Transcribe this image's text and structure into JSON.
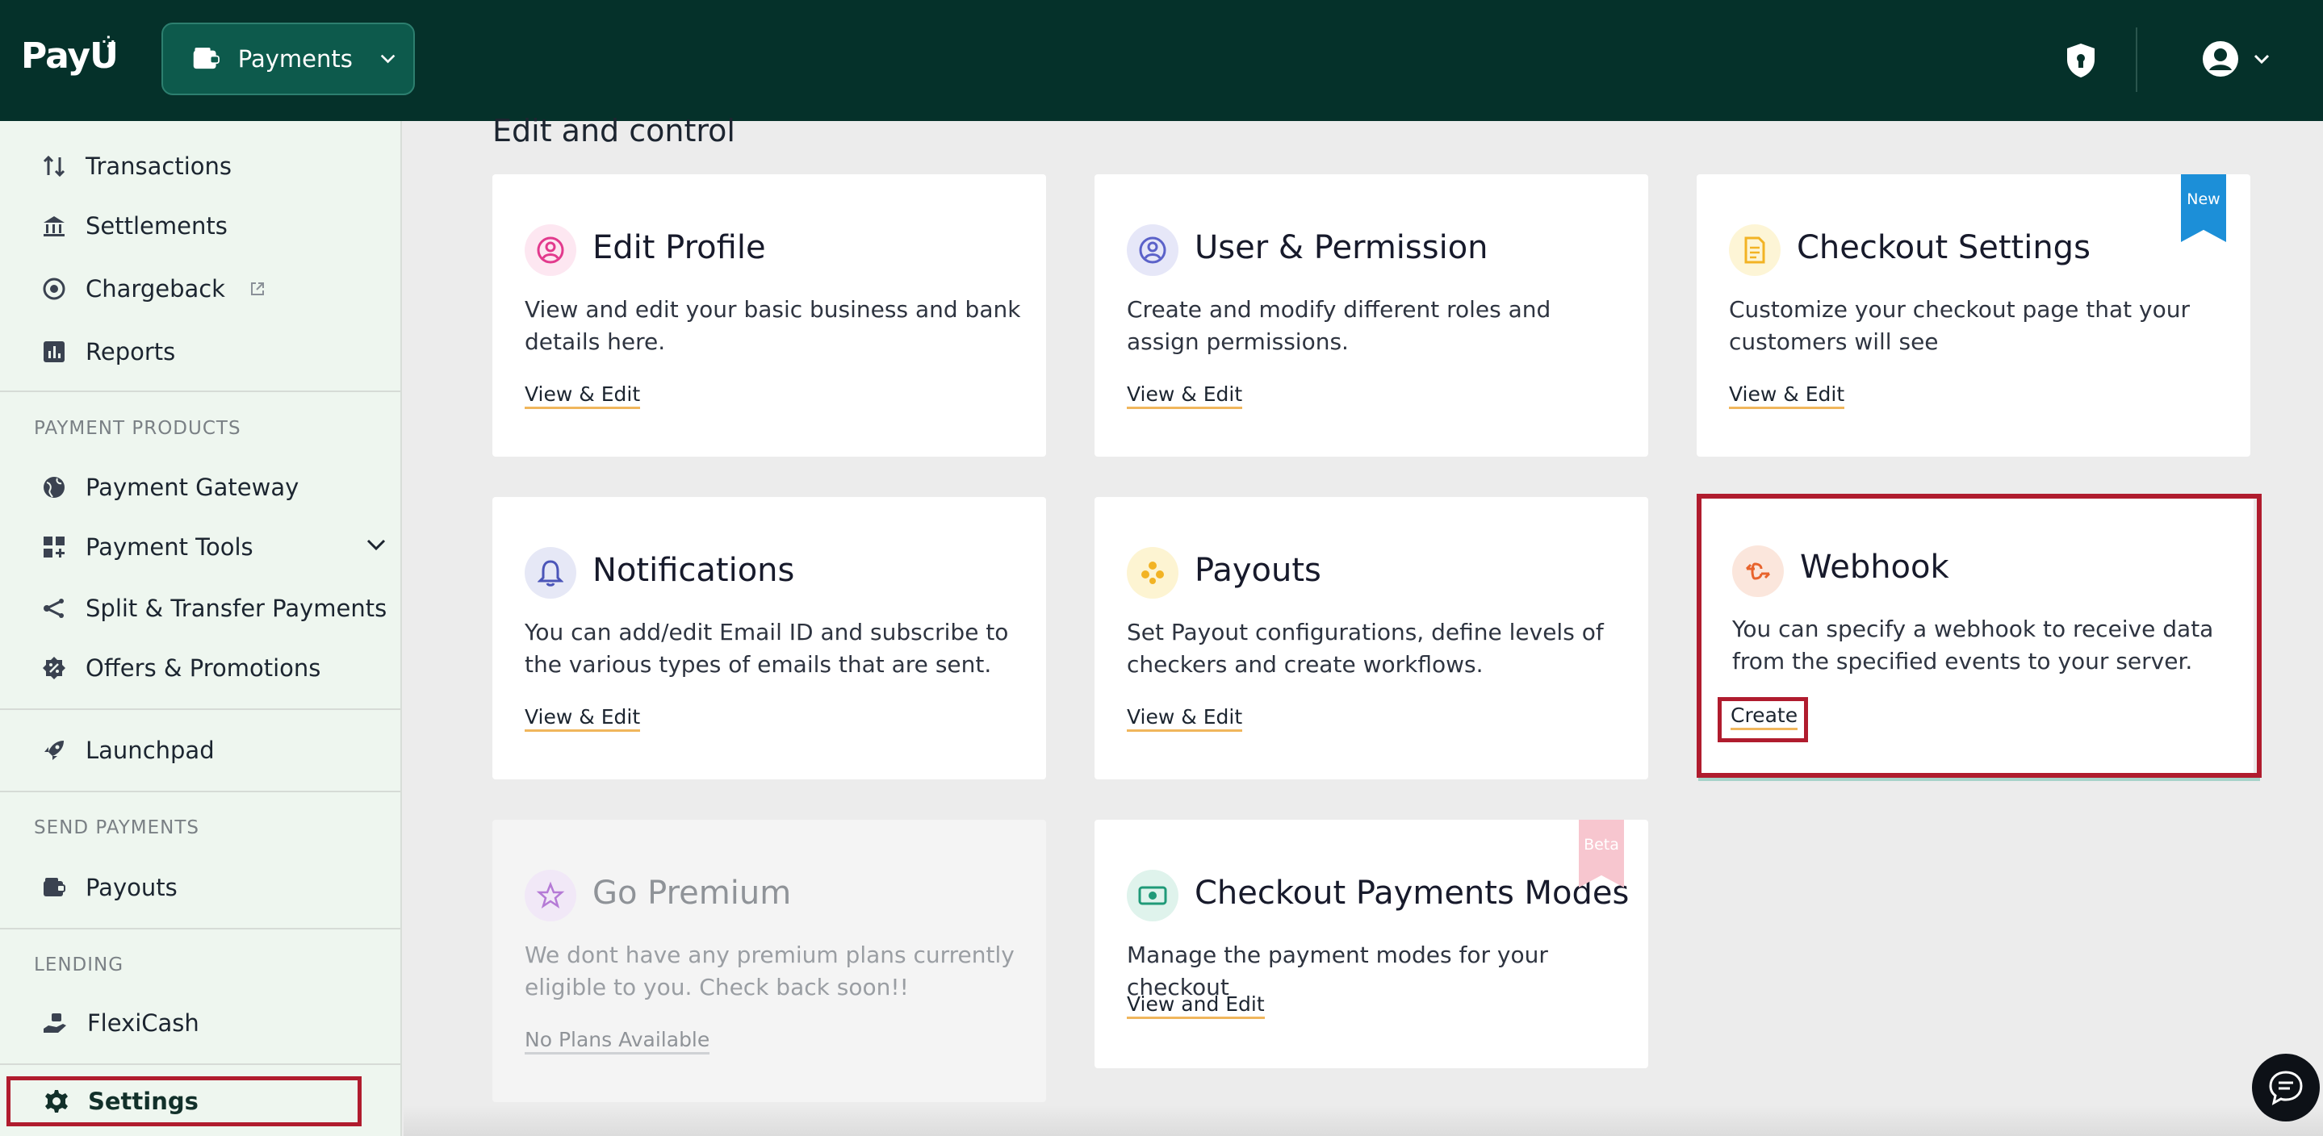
{
  "header": {
    "logo": "PayU",
    "product_switch": "Payments"
  },
  "sidebar": {
    "items_top": [
      {
        "label": "Transactions"
      },
      {
        "label": "Settlements"
      },
      {
        "label": "Chargeback"
      },
      {
        "label": "Reports"
      }
    ],
    "payment_products": {
      "title": "PAYMENT PRODUCTS",
      "items": [
        {
          "label": "Payment Gateway"
        },
        {
          "label": "Payment Tools"
        },
        {
          "label": "Split & Transfer Payments"
        },
        {
          "label": "Offers & Promotions"
        }
      ]
    },
    "launchpad": "Launchpad",
    "send_payments": {
      "title": "SEND PAYMENTS",
      "items": [
        {
          "label": "Payouts"
        }
      ]
    },
    "lending": {
      "title": "LENDING",
      "items": [
        {
          "label": "FlexiCash"
        }
      ]
    },
    "settings": "Settings"
  },
  "main": {
    "section_title": "Edit and control",
    "cards": [
      {
        "title": "Edit Profile",
        "desc": "View and edit your basic business and bank details here.",
        "link": "View & Edit",
        "icon_color": "#e23a8d",
        "icon_bg": "#fde7f1"
      },
      {
        "title": "User & Permission",
        "desc": "Create and modify different roles and assign permissions.",
        "link": "View & Edit",
        "icon_color": "#5b62c9",
        "icon_bg": "#e6e7f8"
      },
      {
        "title": "Checkout Settings",
        "desc": "Customize your checkout page that your customers will see",
        "link": "View & Edit",
        "badge": "New",
        "icon_color": "#f2b324",
        "icon_bg": "#fdf5d6"
      },
      {
        "title": "Notifications",
        "desc": "You can add/edit Email ID and subscribe to the various types of emails that are sent.",
        "link": "View & Edit",
        "icon_color": "#4b55b8",
        "icon_bg": "#e6e8f6"
      },
      {
        "title": "Payouts",
        "desc": "Set Payout configurations, define levels of checkers and create workflows.",
        "link": "View & Edit",
        "icon_color": "#f2b324",
        "icon_bg": "#fdf4d2"
      },
      {
        "title": "Webhook",
        "desc": "You can specify a webhook to receive data from the specified events to your server.",
        "link": "Create",
        "icon_color": "#e8632c",
        "icon_bg": "#fbe6dc"
      },
      {
        "title": "Go Premium",
        "desc": "We dont have any premium plans currently eligible to you. Check back soon!!",
        "link": "No Plans Available",
        "icon_color": "#b57ad6",
        "icon_bg": "#f1e8f7"
      },
      {
        "title": "Checkout Payments Modes",
        "desc": "Manage the payment modes for your checkout",
        "link": "View and Edit",
        "badge": "Beta",
        "icon_color": "#1f9a78",
        "icon_bg": "#dff3ec"
      }
    ]
  },
  "colors": {
    "header_bg": "#05312a",
    "product_switch_bg": "#0d5a4c",
    "sidebar_bg": "#eef6ef",
    "highlight_red": "#b01c2e",
    "new_badge": "#1c8fd8",
    "beta_badge": "#f7c6cf"
  }
}
